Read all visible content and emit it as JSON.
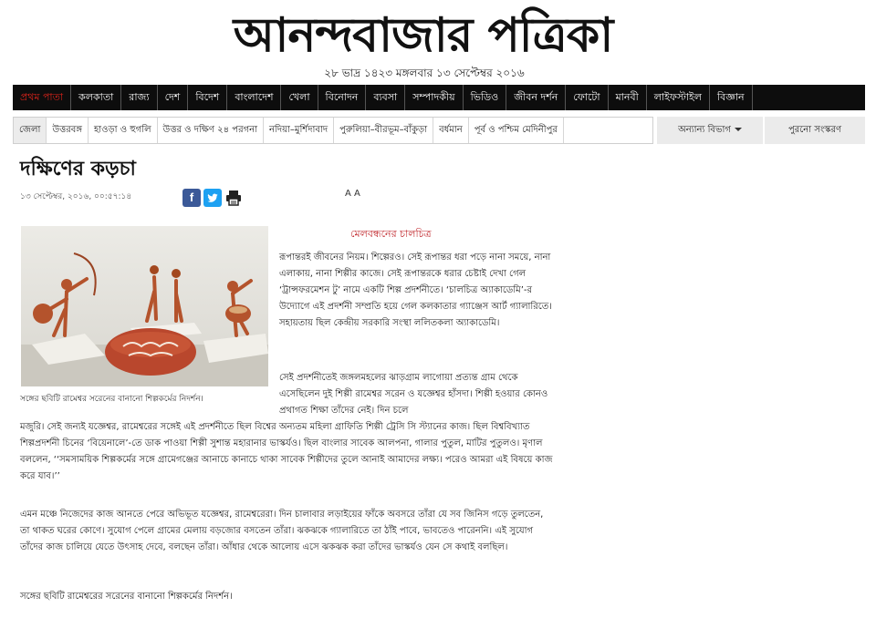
{
  "masthead": {
    "logo_text": "আনন্দবাজার পত্রিকা",
    "date": "২৮ ভাদ্র ১৪২৩ মঙ্গলবার ১৩ সেপ্টেম্বর ২০১৬"
  },
  "nav": {
    "items": [
      "প্রথম পাতা",
      "কলকাতা",
      "রাজ্য",
      "দেশ",
      "বিদেশ",
      "বাংলাদেশ",
      "খেলা",
      "বিনোদন",
      "ব্যবসা",
      "সম্পাদকীয়",
      "ভিডিও",
      "জীবন দর্শন",
      "ফোটো",
      "মানবী",
      "লাইফস্টাইল",
      "বিজ্ঞান"
    ]
  },
  "subnav": {
    "items": [
      "জেলা",
      "উত্তরবঙ্গ",
      "হাওড়া ও হুগলি",
      "উত্তর ও দক্ষিণ ২৪ পরগনা",
      "নদিয়া–মুর্শিদাবাদ",
      "পুরুলিয়া–বীরভূম–বাঁকুড়া",
      "বর্ধমান",
      "পূর্ব ও পশ্চিম মেদিনীপুর"
    ],
    "other_sections": "অন্যান্য বিভাগ",
    "old_edition": "পুরনো সংস্করণ"
  },
  "article": {
    "title": "দক্ষিণের কড়চা",
    "timestamp": "১৩ সেপ্টেম্বর, ২০১৬, ০০:৫৭:১৪",
    "font_controls": "A A",
    "subhead": "মেলবন্ধনের চালচিত্র",
    "caption": "সঙ্গের ছবিটি রামেশ্বর সরেনের বানানো শিল্পকর্মের নিদর্শন।",
    "p1": "রূপান্তরই জীবনের নিয়ম। শিল্পেরও। সেই রূপান্তর ধরা পড়ে নানা সময়ে, নানা এলাকায়, নানা শিল্পীর কাজে। সেই রূপান্তরকে ধরার চেষ্টাই দেখা গেল ‘ট্রান্সফরমেশন টু’ নামে একটি শিল্প প্রদর্শনীতে। ‘চালচিত্র অ্যাকাডেমি’-র উদ্যোগে এই প্রদর্শনী সম্প্রতি হয়ে গেল কলকাতার গ্যাঞ্জেস আর্ট গ্যালারিতে। সহায়তায় ছিল কেন্দ্রীয় সরকারি সংস্থা ললিতকলা অ্যাকাডেমি।",
    "p2a": "সেই প্রদর্শনীতেই জঙ্গলমহলের ঝাড়গ্রাম লাগোয়া প্রত্যন্ত গ্রাম থেকে এসেছিলেন দুই শিল্পী রামেশ্বর সরেন ও যজ্ঞেশ্বর হাঁসদা। শিল্পী হওয়ার কোনও প্রথাগত শিক্ষা তাঁদের নেই। দিন চলে",
    "p2b": "মজুরি। সেই জন্যই যজ্ঞেশ্বর, রামেশ্বরের সঙ্গেই এই প্রদর্শনীতে ছিল বিশ্বের অন্যতম মহিলা গ্রাফিতি শিল্পী ট্রেসি সি স্ট্যানের কাজ। ছিল বিশ্ববিখ্যাত শিল্পপ্রদর্শনী চিনের ‘বিয়েনালে’-তে ডাক পাওয়া শিল্পী সুশান্ত মহারানার ভাস্কর্যও। ছিল বাংলার সাবেক আলপনা, গালার পুতুল, মাটির পুতুলও। মৃণাল বললেন, ‘‘সমসাময়িক শিল্পকর্মের সঙ্গে গ্রামেগঞ্জের আনাচে কানাচে থাকা সাবেক শিল্পীদের তুলে আনাই আমাদের লক্ষ্য। পরেও আমরা এই বিষয়ে কাজ করে যাব।’’",
    "p3": "এমন মঞ্চে নিজেদের কাজ আনতে পেরে অভিভূত যজ্ঞেশ্বর, রামেশ্বরেরা। দিন চালাবার লড়াইয়ের ফাঁকে অবসরে তাঁরা যে সব জিনিস গড়ে তুলতেন, তা থাকত ঘরের কোণে। সুযোগ পেলে গ্রামের মেলায় বড়জোর বসতেন তাঁরা। ঝকঝকে গ্যালারিতে তা ঠাঁই পাবে, ভাবতেও পারেননি। এই সুযোগ তাঁদের কাজ চালিয়ে যেতে উৎসাহ দেবে, বলছেন তাঁরা। আঁধার থেকে আলোয় এসে ঝকঝক করা তাঁদের ভাস্কর্যও যেন সে কথাই বলছিল।",
    "p4": "সঙ্গের ছবিটি রামেশ্বরের সরেনের বানানো শিল্পকর্মের নিদর্শন।"
  },
  "colors": {
    "nav_bg": "#0d0d0d",
    "nav_active": "#e0241b",
    "subhead": "#c0262b",
    "facebook": "#3b5998",
    "twitter": "#1da1f2"
  }
}
